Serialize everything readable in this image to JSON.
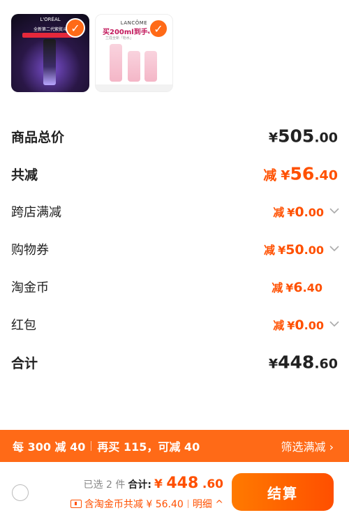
{
  "products": [
    {
      "name": "loreal-product",
      "thumb_text": {
        "logo": "L'ORÉAL",
        "banner": "全新第二代紫熨斗",
        "sub": "开启抗抗紧致"
      }
    },
    {
      "name": "lancome-product",
      "thumb_text": {
        "brand": "LANCÔME",
        "promo": "买200ml到手4",
        "sub": "兰蔻全新「粉水」"
      }
    }
  ],
  "summary_rows": [
    {
      "label": "商品总价",
      "currency": "¥",
      "int": "505",
      "dec": ".00"
    },
    {
      "label": "共减",
      "prefix": "减",
      "currency": "¥",
      "int": "56",
      "dec": ".40"
    },
    {
      "label": "跨店满减",
      "prefix": "减",
      "currency": "¥",
      "int": "0",
      "dec": ".00"
    },
    {
      "label": "购物券",
      "prefix": "减",
      "currency": "¥",
      "int": "50",
      "dec": ".00"
    },
    {
      "label": "淘金币",
      "prefix": "减",
      "currency": "¥",
      "int": "6",
      "dec": ".40"
    },
    {
      "label": "红包",
      "prefix": "减",
      "currency": "¥",
      "int": "0",
      "dec": ".00"
    },
    {
      "label": "合计",
      "currency": "¥",
      "int": "448",
      "dec": ".60"
    }
  ],
  "promo_bar": {
    "part1": "每 300 减 40",
    "part2": "再买 115，可减 40",
    "filter": "筛选满减",
    "filter_chevron": "›"
  },
  "bottom_bar": {
    "selected": "已选 2 件",
    "total_label": "合计:",
    "total_currency": "¥",
    "total_int": "448",
    "total_dec": ".60",
    "coin_note": "含淘金币共减 ¥ 56.40",
    "detail": "明细 ^",
    "pay_label": "结算"
  },
  "colors": {
    "accent": "#ff5000",
    "bar": "#ff6a17"
  }
}
